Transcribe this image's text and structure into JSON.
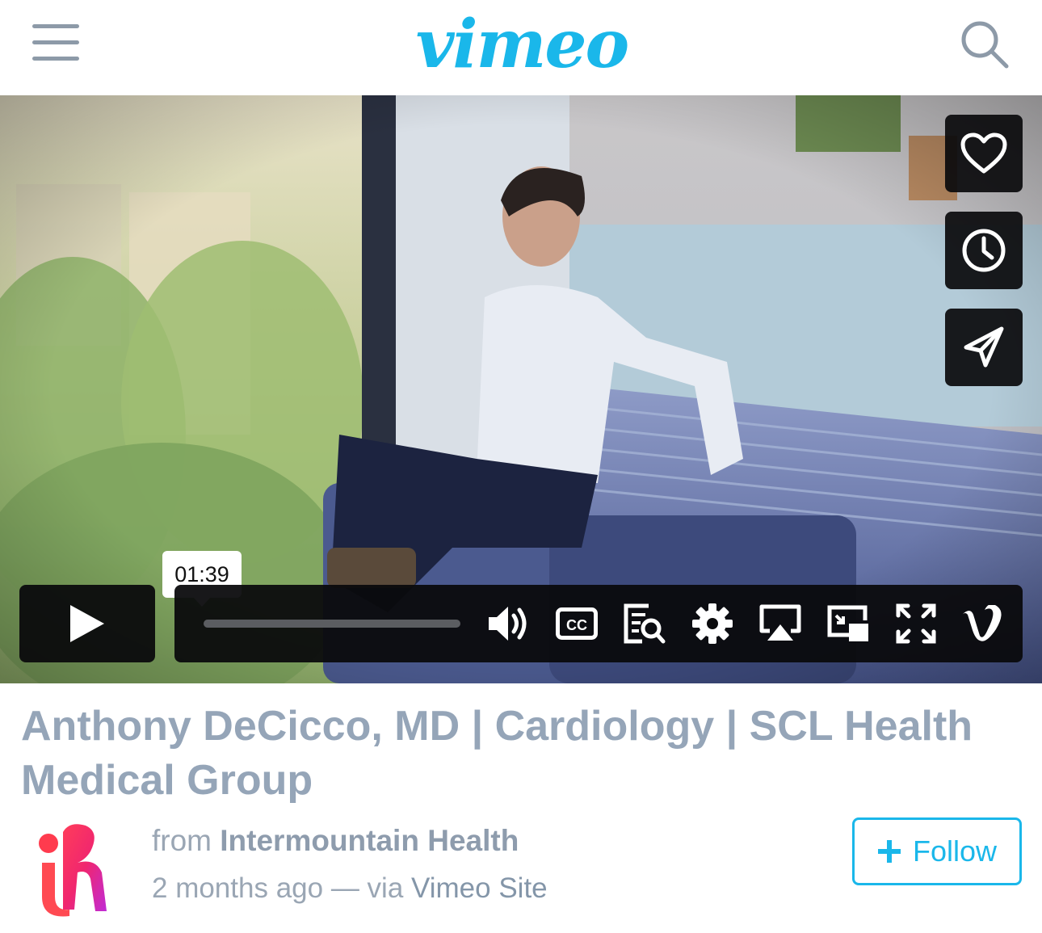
{
  "header": {
    "logo_text": "vimeo",
    "menu_icon": "hamburger-menu-icon",
    "search_icon": "search-icon",
    "brand_color": "#1ab7ea"
  },
  "player": {
    "side_actions": [
      {
        "name": "like-button",
        "icon": "heart-icon"
      },
      {
        "name": "watch-later-button",
        "icon": "clock-icon"
      },
      {
        "name": "share-button",
        "icon": "paper-plane-icon"
      }
    ],
    "hover_time": "01:39",
    "progress": 0.0,
    "controls": [
      {
        "name": "volume-button",
        "icon": "speaker-icon"
      },
      {
        "name": "captions-button",
        "icon": "cc-icon",
        "label": "CC"
      },
      {
        "name": "transcript-button",
        "icon": "transcript-search-icon"
      },
      {
        "name": "settings-button",
        "icon": "gear-icon"
      },
      {
        "name": "airplay-button",
        "icon": "airplay-icon"
      },
      {
        "name": "picture-in-picture-button",
        "icon": "pip-icon"
      },
      {
        "name": "fullscreen-button",
        "icon": "fullscreen-icon"
      },
      {
        "name": "vimeo-link-button",
        "icon": "vimeo-v-icon"
      }
    ]
  },
  "video": {
    "title": "Anthony DeCicco, MD | Cardiology | SCL Health Medical Group",
    "from_label": "from",
    "channel": "Intermountain Health",
    "age": "2 months ago",
    "via_label": "— via",
    "source": "Vimeo Site",
    "follow_label": "Follow"
  }
}
